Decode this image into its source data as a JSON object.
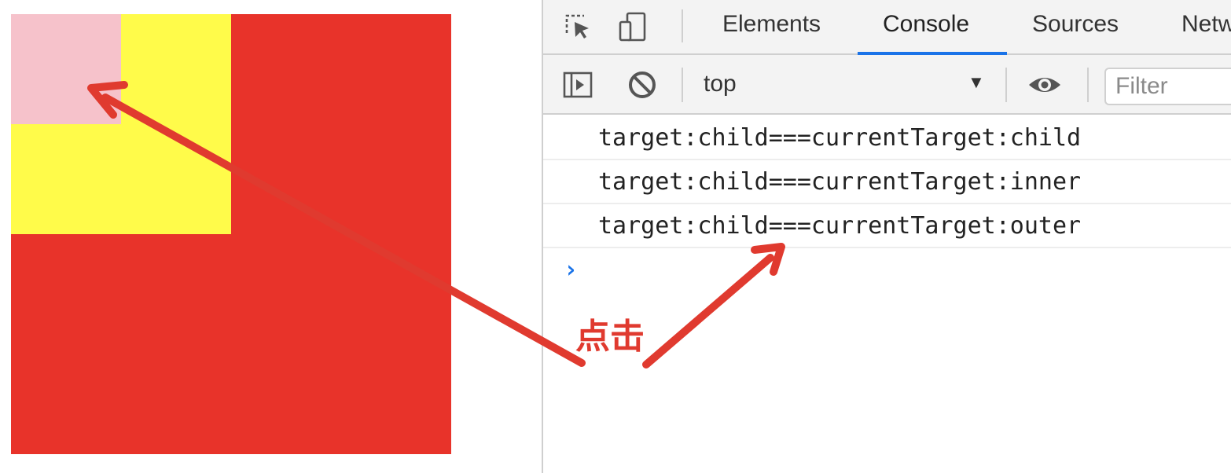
{
  "colors": {
    "outer": "#e8332a",
    "inner": "#fffb4a",
    "child": "#f6c2cb",
    "annotation": "#e03a2f",
    "accent": "#1a73e8"
  },
  "devtools": {
    "toolbar_icons": [
      "inspect-element-icon",
      "device-toolbar-icon"
    ],
    "tabs": [
      {
        "label": "Elements"
      },
      {
        "label": "Console"
      },
      {
        "label": "Sources"
      },
      {
        "label": "Netw"
      }
    ],
    "active_tab": "Console",
    "console_toolbar": {
      "icons": [
        "show-sidebar-icon",
        "clear-console-icon",
        "live-expression-icon"
      ],
      "context_value": "top",
      "context_arrow": "▼",
      "filter_placeholder": "Filter"
    },
    "console_lines": [
      "target:child===currentTarget:child",
      "target:child===currentTarget:inner",
      "target:child===currentTarget:outer"
    ],
    "prompt": "›"
  },
  "annotation": {
    "label": "点击"
  }
}
